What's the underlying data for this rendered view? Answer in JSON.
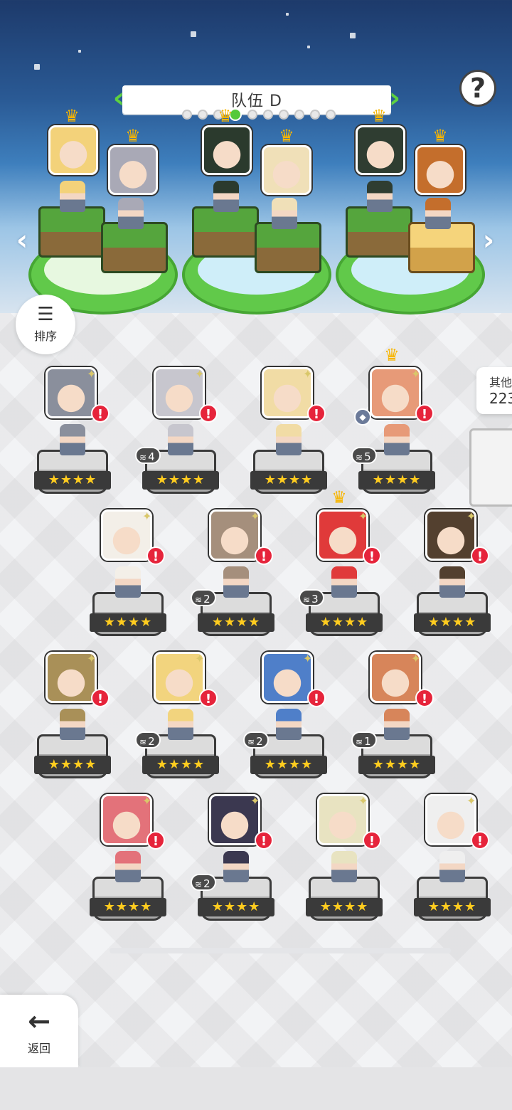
{
  "header": {
    "team_title": "队伍 D",
    "page_count": 10,
    "active_page": 4
  },
  "help": {
    "label": "?"
  },
  "sort": {
    "label": "排序",
    "icon": "sort-descending-icon"
  },
  "side_panel": {
    "line1": "其他",
    "line2": "223"
  },
  "back": {
    "label": "返回",
    "icon": "arrow-left-icon"
  },
  "parties": [
    {
      "members": [
        {
          "color": "#f3d27a",
          "element": "leaf"
        },
        {
          "color": "#a9a9b6",
          "element": "leaf"
        }
      ]
    },
    {
      "members": [
        {
          "color": "#2b3a2d",
          "element": "leaf"
        },
        {
          "color": "#f0e0b8",
          "element": "leaf"
        }
      ]
    },
    {
      "members": [
        {
          "color": "#2f3d31",
          "element": "leaf"
        },
        {
          "color": "#c46e2c",
          "element": "lightning"
        }
      ]
    }
  ],
  "heroes": [
    {
      "color": "#8a8f9c",
      "stars": "★★★★",
      "dupes": "",
      "crown": false
    },
    {
      "color": "#c7c6ce",
      "stars": "★★★★",
      "dupes": "4",
      "crown": false
    },
    {
      "color": "#f1dca5",
      "stars": "★★★★",
      "dupes": "",
      "crown": false
    },
    {
      "color": "#e79a78",
      "stars": "★★★★",
      "dupes": "5",
      "crown": true
    },
    {
      "color": "#f3efe8",
      "stars": "★★★★",
      "dupes": "",
      "crown": false
    },
    {
      "color": "#a58f7c",
      "stars": "★★★★",
      "dupes": "2",
      "crown": false
    },
    {
      "color": "#e03a3a",
      "stars": "★★★★",
      "dupes": "3",
      "crown": true
    },
    {
      "color": "#53402f",
      "stars": "★★★★",
      "dupes": "",
      "crown": false
    },
    {
      "color": "#a99058",
      "stars": "★★★★",
      "dupes": "",
      "crown": false
    },
    {
      "color": "#f2d47e",
      "stars": "★★★★",
      "dupes": "2",
      "crown": false
    },
    {
      "color": "#4f7fc9",
      "stars": "★★★★",
      "dupes": "2",
      "crown": false
    },
    {
      "color": "#d7855a",
      "stars": "★★★★",
      "dupes": "1",
      "crown": false
    },
    {
      "color": "#e3727a",
      "stars": "★★★★",
      "dupes": "",
      "crown": false
    },
    {
      "color": "#3b3850",
      "stars": "★★★★",
      "dupes": "2",
      "crown": false
    },
    {
      "color": "#e8e3c1",
      "stars": "★★★★",
      "dupes": "",
      "crown": false
    },
    {
      "color": "#efefef",
      "stars": "★★★★",
      "dupes": "",
      "crown": false
    }
  ]
}
